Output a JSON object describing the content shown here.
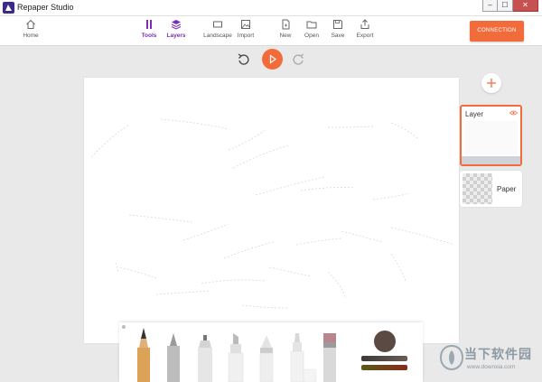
{
  "window": {
    "title": "Repaper Studio",
    "minimize": "–",
    "maximize": "☐",
    "close": "✕"
  },
  "toolbar": {
    "home": "Home",
    "tools": "Tools",
    "layers": "Layers",
    "landscape": "Landscape",
    "import": "Import",
    "new": "New",
    "open": "Open",
    "save": "Save",
    "export": "Export",
    "connection": "CONNECTION"
  },
  "layers": {
    "items": [
      {
        "name": "Layer",
        "selected": true,
        "visible": true
      },
      {
        "name": "Paper",
        "selected": false
      }
    ]
  },
  "colors": {
    "accent": "#f26c3b",
    "active_tab": "#7b2bb5",
    "current_color": "#5b4a44"
  },
  "tools": [
    "pencil",
    "marker",
    "pen",
    "highlighter",
    "crayon",
    "brush",
    "eraser"
  ],
  "watermark": {
    "text": "当下软件园",
    "url": "www.downxia.com"
  }
}
